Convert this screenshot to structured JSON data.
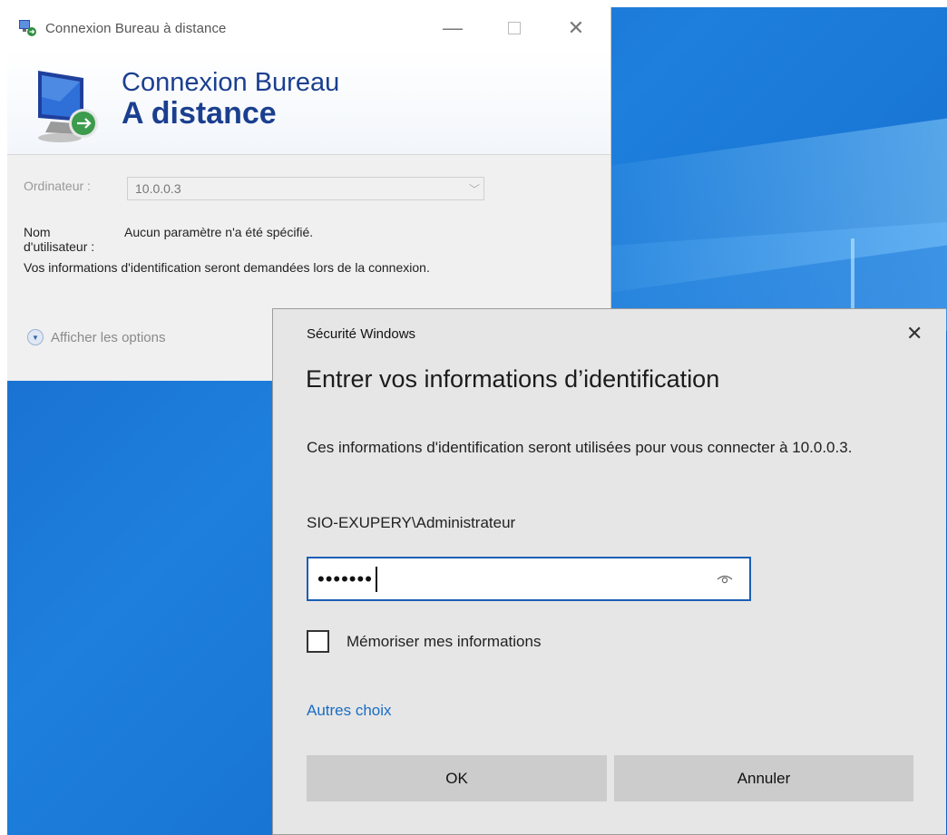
{
  "rdp_window": {
    "title": "Connexion Bureau à distance",
    "banner_line1": "Connexion Bureau",
    "banner_line2": "A distance",
    "ordinateur_label": "Ordinateur :",
    "ordinateur_value": "10.0.0.3",
    "nom_label": "Nom d'utilisateur :",
    "nom_value": "Aucun paramètre n'a été spécifié.",
    "info": "Vos informations d'identification seront demandées lors de la connexion.",
    "options_label": "Afficher les options",
    "controls": {
      "minimize": "—",
      "close": "✕"
    }
  },
  "security_dialog": {
    "title": "Sécurité Windows",
    "close": "✕",
    "heading": "Entrer vos informations d’identification",
    "description": "Ces informations d'identification seront utilisées pour vous connecter à 10.0.0.3.",
    "username": "SIO-EXUPERY\\Administrateur",
    "password_masked": "•••••••",
    "remember_label": "Mémoriser mes informations",
    "remember_checked": false,
    "other_choices": "Autres choix",
    "ok_label": "OK",
    "cancel_label": "Annuler"
  },
  "colors": {
    "accent": "#1a5fb4",
    "link": "#1a6dc4",
    "banner_text": "#1b3f8f",
    "desktop": "#1565c8"
  }
}
